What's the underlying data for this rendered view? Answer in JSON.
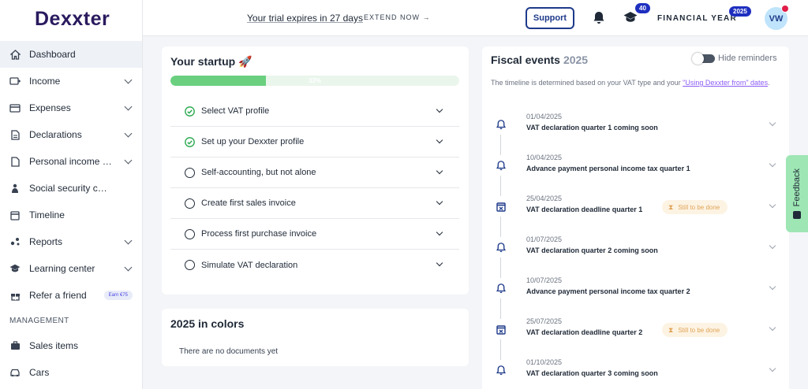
{
  "app": {
    "logo": "Dexxter"
  },
  "header": {
    "trial_text": "Your trial expires in 27 days",
    "extend_label": "EXTEND NOW →",
    "support_label": "Support",
    "learning_badge": "40",
    "fiscal_year_label": "FINANCIAL YEAR",
    "fiscal_year_value": "2025",
    "avatar_initials": "VW"
  },
  "sidebar": {
    "items": [
      {
        "label": "Dashboard",
        "icon": "home-icon",
        "active": true
      },
      {
        "label": "Income",
        "icon": "income-icon"
      },
      {
        "label": "Expenses",
        "icon": "card-icon"
      },
      {
        "label": "Declarations",
        "icon": "document-icon"
      },
      {
        "label": "Personal income t...",
        "icon": "file-icon"
      },
      {
        "label": "Social security contrib...",
        "icon": "person-icon"
      },
      {
        "label": "Timeline",
        "icon": "calendar-icon"
      },
      {
        "label": "Reports",
        "icon": "chart-icon"
      },
      {
        "label": "Learning center",
        "icon": "graduation-cap-icon"
      },
      {
        "label": "Refer a friend",
        "icon": "gift-icon",
        "badge": "Earn €75"
      }
    ],
    "management_label": "MANAGEMENT",
    "management_items": [
      {
        "label": "Sales items",
        "icon": "briefcase-icon"
      },
      {
        "label": "Cars",
        "icon": "car-icon"
      }
    ]
  },
  "startup": {
    "title": "Your startup 🚀",
    "progress_label": "33%",
    "progress_value": 0.33,
    "steps": [
      {
        "label": "Select VAT profile",
        "done": true
      },
      {
        "label": "Set up your Dexxter profile",
        "done": true
      },
      {
        "label": "Self-accounting, but not alone",
        "done": false
      },
      {
        "label": "Create first sales invoice",
        "done": false
      },
      {
        "label": "Process first purchase invoice",
        "done": false
      },
      {
        "label": "Simulate VAT declaration",
        "done": false
      }
    ]
  },
  "colors_card": {
    "title": "2025 in colors",
    "empty_text": "There are no documents yet"
  },
  "fiscal": {
    "title": "Fiscal events",
    "year": "2025",
    "hide_reminders_label": "Hide reminders",
    "note_prefix": "The timeline is determined based on your VAT type and your ",
    "note_link": "\"Using Dexxter from\" dates",
    "note_suffix": ".",
    "pending_label": "Still to be done",
    "events": [
      {
        "date": "01/04/2025",
        "title": "VAT declaration quarter 1 coming soon",
        "type": "reminder"
      },
      {
        "date": "10/04/2025",
        "title": "Advance payment personal income tax quarter 1",
        "type": "reminder"
      },
      {
        "date": "25/04/2025",
        "title": "VAT declaration deadline quarter 1",
        "type": "deadline"
      },
      {
        "date": "01/07/2025",
        "title": "VAT declaration quarter 2 coming soon",
        "type": "reminder"
      },
      {
        "date": "10/07/2025",
        "title": "Advance payment personal income tax quarter 2",
        "type": "reminder"
      },
      {
        "date": "25/07/2025",
        "title": "VAT declaration deadline quarter 2",
        "type": "deadline"
      },
      {
        "date": "01/10/2025",
        "title": "VAT declaration quarter 3 coming soon",
        "type": "reminder"
      }
    ]
  },
  "feedback_label": "Feedback"
}
